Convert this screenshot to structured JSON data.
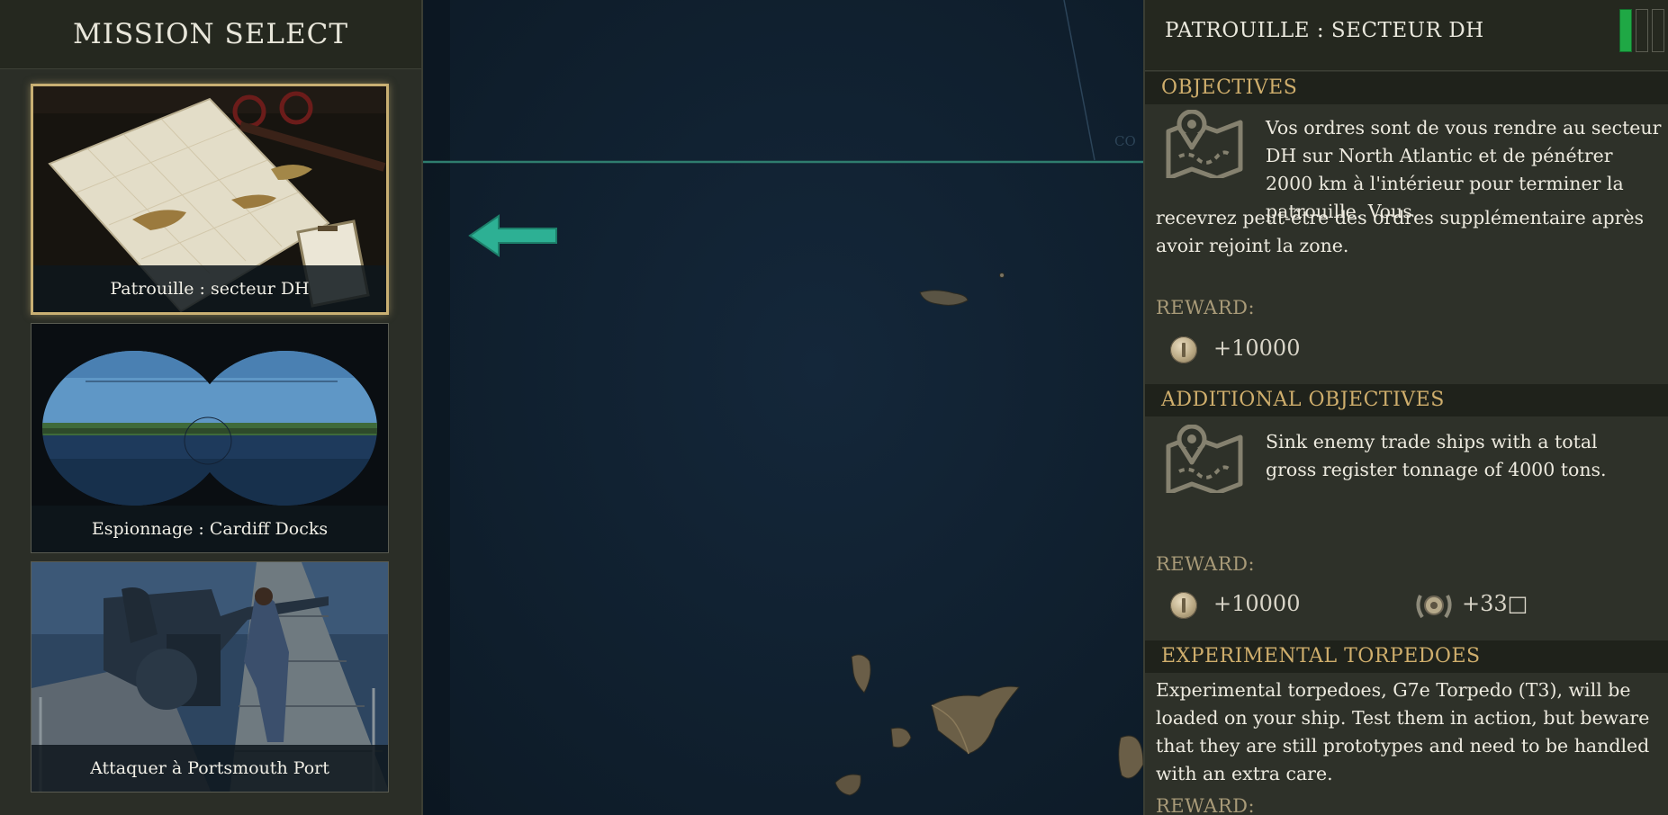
{
  "left_panel": {
    "title": "MISSION SELECT",
    "missions": [
      {
        "label": "Patrouille : secteur DH",
        "selected": true
      },
      {
        "label": "Espionnage : Cardiff Docks",
        "selected": false
      },
      {
        "label": "Attaquer à Portsmouth Port",
        "selected": false
      }
    ]
  },
  "map": {
    "faint_label": "CO"
  },
  "right_panel": {
    "title": "PATROUILLE : SECTEUR DH",
    "progress": {
      "filled": 1,
      "total": 3,
      "fill_color": "#1fa845"
    },
    "objectives": {
      "heading": "OBJECTIVES",
      "text": "Vos ordres sont de vous rendre au secteur DH sur North Atlantic et de pénétrer 2000 km à l'intérieur pour terminer la patrouille. Vous recevrez peut-être des ordres supplémentaire après avoir rejoint la zone.",
      "reward_label": "REWARD:",
      "reward_value": "+10000"
    },
    "additional": {
      "heading": "ADDITIONAL OBJECTIVES",
      "text": "Sink enemy trade ships with a total gross register tonnage of 4000 tons.",
      "reward_label": "REWARD:",
      "reward_value": "+10000",
      "reward_value_2": "+33□"
    },
    "experimental": {
      "heading": "EXPERIMENTAL TORPEDOES",
      "text": "Experimental torpedoes, G7e Torpedo (T3), will be loaded on your ship. Test them in action, but beware that they are still prototypes and need to be handled with an extra care.",
      "reward_label": "REWARD:"
    }
  },
  "colors": {
    "accent_gold": "#cfae6c",
    "arrow_teal": "#2fb89a",
    "sea": "#10202f"
  }
}
